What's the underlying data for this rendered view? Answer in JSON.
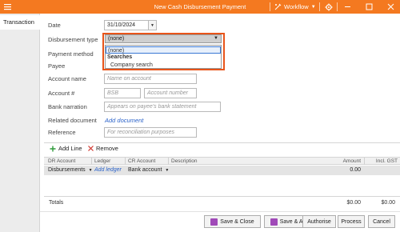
{
  "window": {
    "title": "New Cash Disbursement Payment",
    "workflow_label": "Workflow",
    "accent": "#f47920"
  },
  "tabs": [
    {
      "label": "Transaction",
      "active": true
    }
  ],
  "form": {
    "date": {
      "label": "Date",
      "value": "31/10/2024"
    },
    "disbursement_type": {
      "label": "Disbursement type",
      "value": "(none)",
      "options": {
        "none": "(none)",
        "group": "Searches",
        "item": "Company search"
      }
    },
    "payment_method": {
      "label": "Payment method"
    },
    "payee": {
      "label": "Payee"
    },
    "account_name": {
      "label": "Account name",
      "placeholder": "Name on account"
    },
    "account_no": {
      "label": "Account #",
      "bsb_placeholder": "BSB",
      "number_placeholder": "Account number"
    },
    "bank_narration": {
      "label": "Bank narration",
      "placeholder": "Appears on payee's bank statement"
    },
    "related_document": {
      "label": "Related document",
      "link": "Add document"
    },
    "reference": {
      "label": "Reference",
      "placeholder": "For reconciliation purposes"
    }
  },
  "grid_toolbar": {
    "add_line": "Add Line",
    "remove": "Remove"
  },
  "grid": {
    "columns": [
      "DR Account",
      "Ledger",
      "CR Account",
      "Description",
      "Amount",
      "Incl. GST"
    ],
    "row": {
      "dr_account": "Disbursements",
      "ledger_link": "Add ledger",
      "cr_account": "Bank account",
      "amount": "0.00"
    }
  },
  "totals": {
    "label": "Totals",
    "amount": "$0.00",
    "gst": "$0.00"
  },
  "buttons": {
    "save_close": "Save & Close",
    "save_add": "Save & Add",
    "authorise": "Authorise",
    "process": "Process",
    "cancel": "Cancel"
  }
}
